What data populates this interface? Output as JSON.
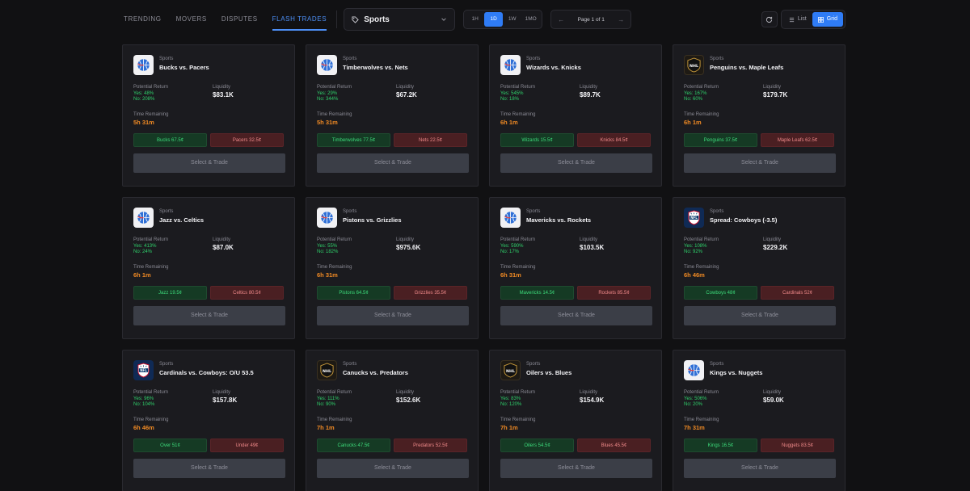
{
  "tabs": [
    {
      "label": "TRENDING"
    },
    {
      "label": "MOVERS"
    },
    {
      "label": "DISPUTES"
    },
    {
      "label": "FLASH TRADES",
      "active": true
    }
  ],
  "category_select": {
    "label": "Sports",
    "icon": "tag-icon"
  },
  "timeframes": [
    {
      "label": "1H"
    },
    {
      "label": "1D",
      "active": true
    },
    {
      "label": "1W"
    },
    {
      "label": "1MO"
    }
  ],
  "pager": {
    "text": "Page 1 of 1",
    "prev": "←",
    "next": "→"
  },
  "view_toggle": {
    "list": "List",
    "grid": "Grid",
    "active": "grid"
  },
  "labels": {
    "potential_return": "Potential Return",
    "liquidity": "Liquidity",
    "time_remaining": "Time Remaining",
    "select_trade": "Select & Trade"
  },
  "colors": {
    "accent": "#2f7cf6",
    "yes": "#2fd26b",
    "no_btn": "#4a1f22",
    "time": "#f08a24"
  },
  "cards": [
    {
      "league": "nba",
      "category": "Sports",
      "title": "Bucks vs. Pacers",
      "yes": "Yes: 48%",
      "no": "No: 208%",
      "liquidity": "$83.1K",
      "time": "5h 31m",
      "yes_btn": "Bucks 67.5¢",
      "no_btn": "Pacers 32.5¢"
    },
    {
      "league": "nba",
      "category": "Sports",
      "title": "Timberwolves vs. Nets",
      "yes": "Yes: 29%",
      "no": "No: 344%",
      "liquidity": "$67.2K",
      "time": "5h 31m",
      "yes_btn": "Timberwolves 77.5¢",
      "no_btn": "Nets 22.5¢"
    },
    {
      "league": "nba",
      "category": "Sports",
      "title": "Wizards vs. Knicks",
      "yes": "Yes: 545%",
      "no": "No: 18%",
      "liquidity": "$89.7K",
      "time": "6h 1m",
      "yes_btn": "Wizards 15.5¢",
      "no_btn": "Knicks 84.5¢"
    },
    {
      "league": "nhl",
      "category": "Sports",
      "title": "Penguins vs. Maple Leafs",
      "yes": "Yes: 167%",
      "no": "No: 60%",
      "liquidity": "$179.7K",
      "time": "6h 1m",
      "yes_btn": "Penguins 37.5¢",
      "no_btn": "Maple Leafs 62.5¢"
    },
    {
      "league": "nba",
      "category": "Sports",
      "title": "Jazz vs. Celtics",
      "yes": "Yes: 413%",
      "no": "No: 24%",
      "liquidity": "$87.0K",
      "time": "6h 1m",
      "yes_btn": "Jazz 19.5¢",
      "no_btn": "Celtics 80.5¢"
    },
    {
      "league": "nba",
      "category": "Sports",
      "title": "Pistons vs. Grizzlies",
      "yes": "Yes: 55%",
      "no": "No: 182%",
      "liquidity": "$975.6K",
      "time": "6h 31m",
      "yes_btn": "Pistons 64.5¢",
      "no_btn": "Grizzlies 35.5¢"
    },
    {
      "league": "nba",
      "category": "Sports",
      "title": "Mavericks vs. Rockets",
      "yes": "Yes: 590%",
      "no": "No: 17%",
      "liquidity": "$103.5K",
      "time": "6h 31m",
      "yes_btn": "Mavericks 14.5¢",
      "no_btn": "Rockets 85.5¢"
    },
    {
      "league": "nfl",
      "category": "Sports",
      "title": "Spread: Cowboys (-3.5)",
      "yes": "Yes: 108%",
      "no": "No: 92%",
      "liquidity": "$229.2K",
      "time": "6h 46m",
      "yes_btn": "Cowboys 48¢",
      "no_btn": "Cardinals 52¢"
    },
    {
      "league": "nfl",
      "category": "Sports",
      "title": "Cardinals vs. Cowboys: O/U 53.5",
      "yes": "Yes: 96%",
      "no": "No: 104%",
      "liquidity": "$157.8K",
      "time": "6h 46m",
      "yes_btn": "Over 51¢",
      "no_btn": "Under 49¢"
    },
    {
      "league": "nhl",
      "category": "Sports",
      "title": "Canucks vs. Predators",
      "yes": "Yes: 111%",
      "no": "No: 90%",
      "liquidity": "$152.6K",
      "time": "7h 1m",
      "yes_btn": "Canucks 47.5¢",
      "no_btn": "Predators 52.5¢"
    },
    {
      "league": "nhl",
      "category": "Sports",
      "title": "Oilers vs. Blues",
      "yes": "Yes: 83%",
      "no": "No: 120%",
      "liquidity": "$154.9K",
      "time": "7h 1m",
      "yes_btn": "Oilers 54.5¢",
      "no_btn": "Blues 45.5¢"
    },
    {
      "league": "nba",
      "category": "Sports",
      "title": "Kings vs. Nuggets",
      "yes": "Yes: 506%",
      "no": "No: 20%",
      "liquidity": "$59.0K",
      "time": "7h 31m",
      "yes_btn": "Kings 16.5¢",
      "no_btn": "Nuggets 83.5¢"
    }
  ]
}
